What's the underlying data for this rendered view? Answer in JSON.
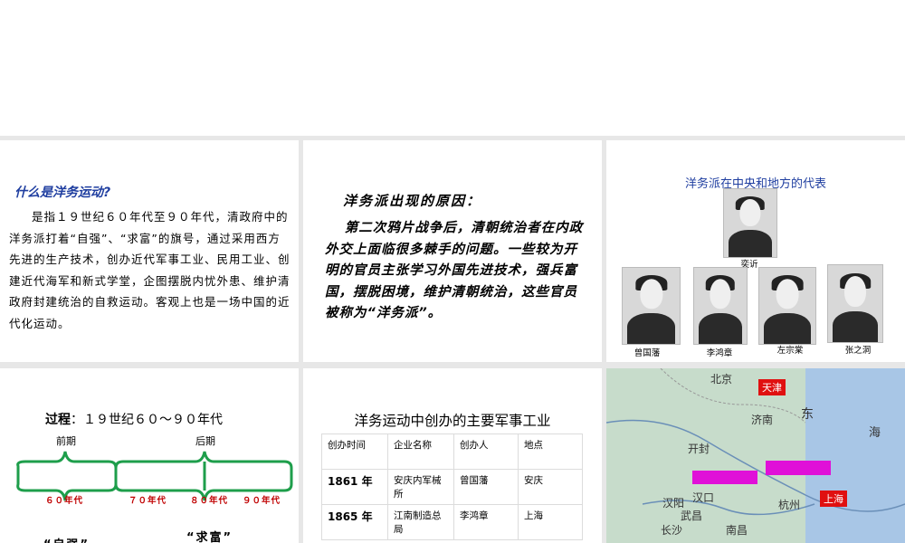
{
  "slide1": {
    "title": "什么是洋务运动?",
    "body": "是指１９世纪６０年代至９０年代，清政府中的洋务派打着“自强”、“求富”的旗号，通过采用西方先进的生产技术，创办近代军事工业、民用工业、创建近代海军和新式学堂，企图摆脱内忧外患、维护清政府封建统治的自救运动。客观上也是一场中国的近代化运动。"
  },
  "slide2": {
    "title": "洋务派出现的原因：",
    "body": "第二次鸦片战争后，清朝统治者在内政外交上面临很多棘手的问题。一些较为开明的官员主张学习外国先进技术，强兵富国，摆脱困境，维护清朝统治，这些官员被称为“洋务派”。"
  },
  "slide3": {
    "title": "洋务派在中央和地方的代表",
    "center_name": "奕䜣",
    "names": [
      "曾国藩",
      "李鸿章",
      "左宗棠",
      "张之洞"
    ]
  },
  "slide4": {
    "title_bold": "过程",
    "title_rest": "：１９世纪６０～９０年代",
    "early": "前期",
    "late": "后期",
    "decades": [
      "６０年代",
      "７０年代",
      "８０年代",
      "９０年代"
    ],
    "quote_left": "“自强”",
    "quote_right": "“求富”"
  },
  "slide5": {
    "title": "洋务运动中创办的主要军事工业",
    "headers": [
      "创办时间",
      "企业名称",
      "创办人",
      "地点"
    ],
    "rows": [
      [
        "1861 年",
        "安庆内军械所",
        "曾国藩",
        "安庆"
      ],
      [
        "1865 年",
        "江南制造总局",
        "李鸿章",
        "上海"
      ]
    ]
  },
  "slide6": {
    "tags": [
      "天津",
      "上海"
    ],
    "labels": [
      "北京",
      "济南",
      "开封",
      "汉口",
      "汉阳",
      "武昌",
      "杭州",
      "长沙",
      "南昌",
      "东",
      "海"
    ]
  }
}
